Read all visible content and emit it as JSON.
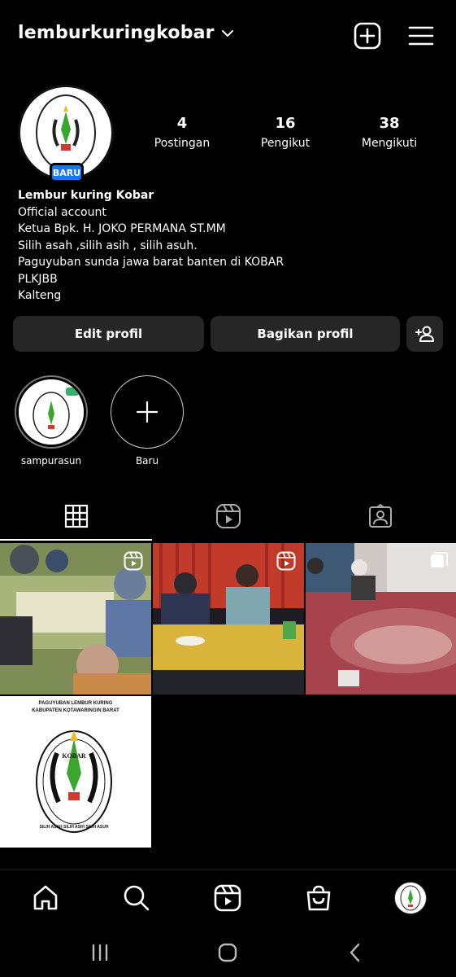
{
  "header": {
    "username": "lemburkuringkobar",
    "icons": [
      "chevron-down-icon",
      "add-post-icon",
      "menu-icon"
    ]
  },
  "profile": {
    "avatar_label": "PAGUYUBAN LEMBUR KURING KOBAR SILIH ASAH SILIH ASIH SILIH ASUH",
    "badge": "BARU",
    "stats": [
      {
        "value": "4",
        "label": "Postingan"
      },
      {
        "value": "16",
        "label": "Pengikut"
      },
      {
        "value": "38",
        "label": "Mengikuti"
      }
    ],
    "bio": {
      "name": "Lembur kuring Kobar",
      "lines": [
        "Official account",
        "Ketua Bpk. H. JOKO PERMANA ST.MM",
        "Silih asah ,silih asih , silih asuh.",
        "Paguyuban sunda jawa barat banten di KOBAR",
        "PLKJBB",
        "Kalteng"
      ]
    }
  },
  "actions": {
    "edit": "Edit profil",
    "share": "Bagikan profil"
  },
  "highlights": [
    {
      "label": "sampurasun"
    },
    {
      "label": "Baru"
    }
  ],
  "post4": {
    "line1": "PAGUYUBAN LEMBUR KURING",
    "line2": "KABUPATEN KOTAWARINGIN BARAT",
    "ring_top": "PAGUYUBAN LEMBUR KURING",
    "kobar": "KOBAR",
    "ring_bottom": "SILIH ASAH SILIH ASIH SILIH ASUH"
  },
  "colors": {
    "background": "#000000",
    "button": "#262626",
    "badge": "#1877f2"
  }
}
